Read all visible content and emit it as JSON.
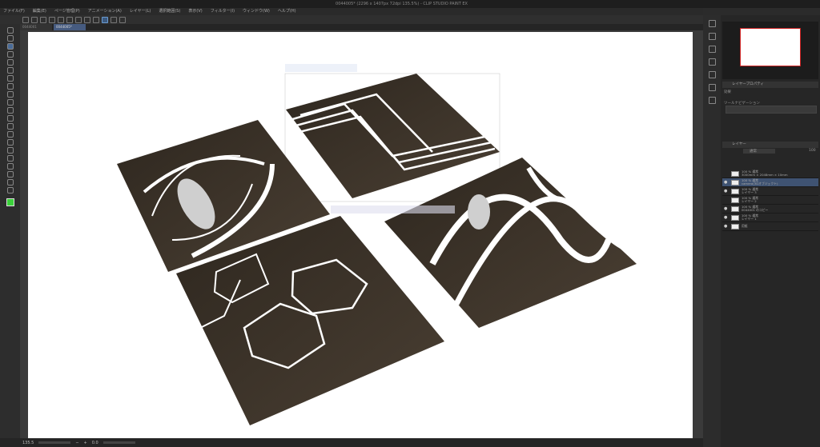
{
  "window": {
    "title": "0044005* (2296 x 1407px 72dpi 135.5%) - CLIP STUDIO PAINT EX"
  },
  "menu": [
    "ファイル(F)",
    "編集(E)",
    "ページ管理(P)",
    "アニメーション(A)",
    "レイヤー(L)",
    "選択範囲(S)",
    "表示(V)",
    "フィルター(I)",
    "ウィンドウ(W)",
    "ヘルプ(H)"
  ],
  "tabs": [
    {
      "label": "0044001"
    },
    {
      "label": "0044005*"
    }
  ],
  "status": {
    "zoom": "135.5",
    "angle": "0.0"
  },
  "panels": {
    "layer_property": "レイヤープロパティ",
    "effect": "効果",
    "tool_navigation": "ツールナビゲーション",
    "layer_tab": "レイヤー",
    "blend_mode": "通常",
    "opacity": "100"
  },
  "layers": [
    {
      "mode": "100 % 通常",
      "name": "3000mm × 2048mm × 10mm",
      "visible": false
    },
    {
      "mode": "100 % 通常",
      "name": "camera(3Dオブジェクト)",
      "visible": true,
      "selected": true
    },
    {
      "mode": "100 % 通常",
      "name": "レイヤー 3",
      "visible": true
    },
    {
      "mode": "100 % 通常",
      "name": "レイヤー 2",
      "visible": false
    },
    {
      "mode": "100 % 通常",
      "name": "0044001 のコピー",
      "visible": true
    },
    {
      "mode": "100 % 通常",
      "name": "レイヤー 1",
      "visible": true
    },
    {
      "mode": "",
      "name": "用紙",
      "visible": true
    }
  ],
  "colors": {
    "tile": "#3b3228",
    "accent": "#4a6c99",
    "main_color": "#3ad13a"
  }
}
